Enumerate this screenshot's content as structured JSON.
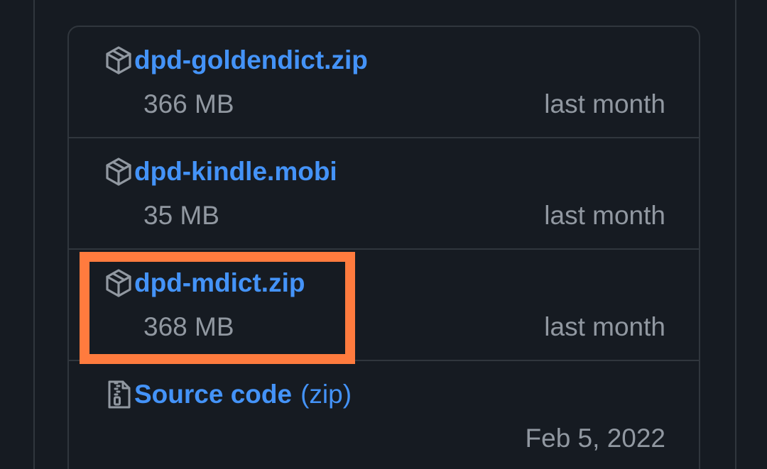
{
  "assets": [
    {
      "name": "dpd-goldendict.zip",
      "size": "366 MB",
      "date": "last month",
      "icon": "package-icon"
    },
    {
      "name": "dpd-kindle.mobi",
      "size": "35 MB",
      "date": "last month",
      "icon": "package-icon"
    },
    {
      "name": "dpd-mdict.zip",
      "size": "368 MB",
      "date": "last month",
      "icon": "package-icon"
    },
    {
      "name": "Source code",
      "suffix": "(zip)",
      "date": "Feb 5, 2022",
      "icon": "file-zip-icon"
    }
  ],
  "colors": {
    "background": "#161b22",
    "border": "#30363d",
    "link": "#4493f8",
    "muted": "#9198a1",
    "highlight": "#ff7b3e"
  }
}
